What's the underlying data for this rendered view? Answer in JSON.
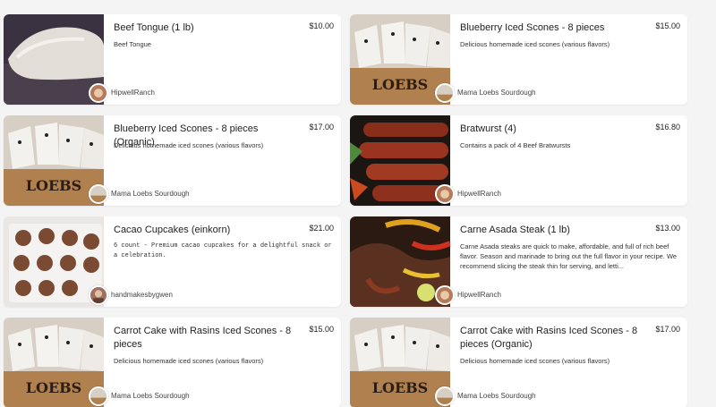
{
  "products": [
    {
      "title": "Beef Tongue (1 lb)",
      "price": "$10.00",
      "description": "Beef Tongue",
      "seller": "HipwellRanch",
      "image_icon": "beef-tongue-image"
    },
    {
      "title": "Blueberry Iced Scones - 8 pieces",
      "price": "$15.00",
      "description": "Delicious homemade iced scones (various flavors)",
      "seller": "Mama Loebs Sourdough",
      "image_icon": "scones-image"
    },
    {
      "title": "Blueberry Iced Scones - 8 pieces (Organic)",
      "price": "$17.00",
      "description": "Delicious homemade iced scones (various flavors)",
      "seller": "Mama Loebs Sourdough",
      "image_icon": "scones-image"
    },
    {
      "title": "Bratwurst (4)",
      "price": "$16.80",
      "description": "Contains a pack of 4 Beef Bratwursts",
      "seller": "HipwellRanch",
      "image_icon": "bratwurst-image"
    },
    {
      "title": "Cacao Cupcakes (einkorn)",
      "price": "$21.00",
      "description": "6 count - Premium cacao cupcakes for a delightful snack or a celebration.",
      "seller": "handmakesbygwen",
      "image_icon": "cupcakes-image"
    },
    {
      "title": "Carne Asada Steak (1 lb)",
      "price": "$13.00",
      "description": "Carne Asada steaks are quick to make, affordable, and full of rich beef flavor. Season and marinade to bring out the full flavor in your recipe. We recommend slicing the steak thin for serving, and letti...",
      "seller": "HipwellRanch",
      "image_icon": "carne-asada-image"
    },
    {
      "title": "Carrot Cake with Rasins Iced Scones - 8 pieces",
      "price": "$15.00",
      "description": "Delicious homemade iced scones (various flavors)",
      "seller": "Mama Loebs Sourdough",
      "image_icon": "scones-image"
    },
    {
      "title": "Carrot Cake with Rasins Iced Scones - 8 pieces (Organic)",
      "price": "$17.00",
      "description": "Delicious homemade iced scones (various flavors)",
      "seller": "Mama Loebs Sourdough",
      "image_icon": "scones-image"
    }
  ],
  "colors": {
    "card_bg": "#ffffff",
    "page_bg": "#f4f4f5",
    "text": "#222222"
  }
}
